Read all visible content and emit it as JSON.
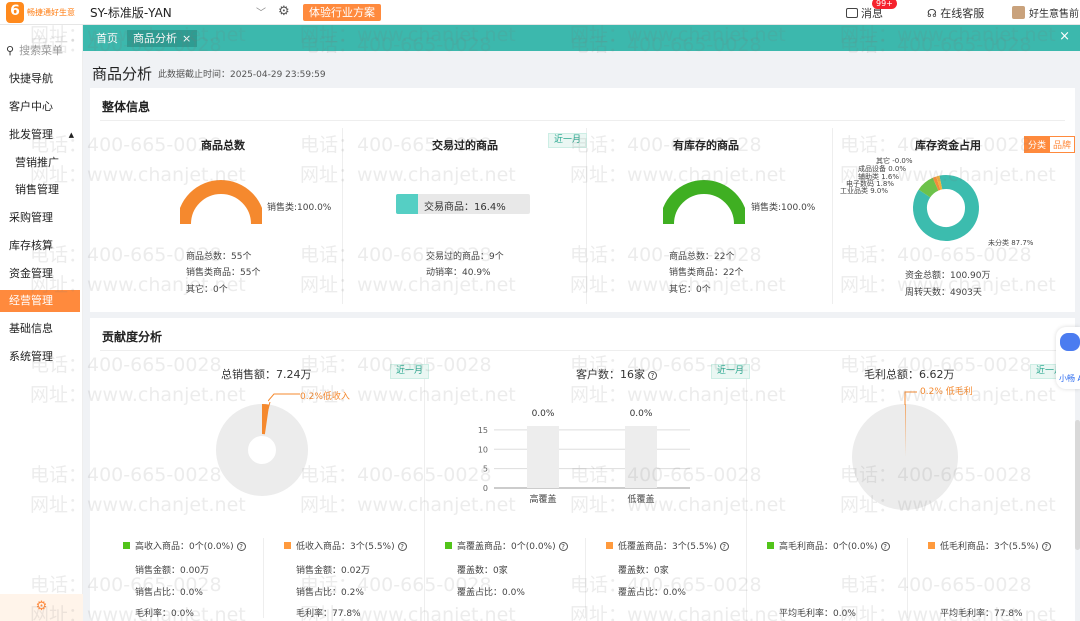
{
  "header": {
    "logo_text": "畅捷通好生意",
    "logo_sub": "标准版",
    "org_name": "SY-标准版-YAN",
    "plan_button": "体验行业方案",
    "messages_label": "消息",
    "messages_badge": "99+",
    "service_label": "在线客服",
    "user_name": "好生意售前"
  },
  "sidebar": {
    "search_placeholder": "搜索菜单",
    "items": [
      {
        "label": "快捷导航"
      },
      {
        "label": "客户中心"
      },
      {
        "label": "批发管理"
      },
      {
        "label": "营销推广"
      },
      {
        "label": "销售管理"
      },
      {
        "label": "采购管理"
      },
      {
        "label": "库存核算"
      },
      {
        "label": "资金管理"
      },
      {
        "label": "经营管理"
      },
      {
        "label": "基础信息"
      },
      {
        "label": "系统管理"
      }
    ]
  },
  "tabs": [
    {
      "label": "首页"
    },
    {
      "label": "商品分析",
      "close": "×"
    }
  ],
  "tabbar_close": "×",
  "page": {
    "title": "商品分析",
    "subtitle": "此数据截止时间：2025-04-29 23:59:59"
  },
  "overall": {
    "title": "整体信息",
    "total_goods": {
      "title": "商品总数",
      "donut_label": "销售类:100.0%",
      "lines": [
        "商品总数：55个",
        "销售类商品：55个",
        "其它：0个"
      ]
    },
    "traded_goods": {
      "title": "交易过的商品",
      "tag": "近一月",
      "bar_label": "交易商品：16.4%",
      "bar_fraction": 0.164,
      "lines": [
        "交易过的商品：9个",
        "动销率：40.9%"
      ]
    },
    "stocked_goods": {
      "title": "有库存的商品",
      "donut_label": "销售类:100.0%",
      "lines": [
        "商品总数：22个",
        "销售类商品：22个",
        "其它：0个"
      ]
    },
    "inventory_capital": {
      "title": "库存资金占用",
      "toggle": [
        "分类",
        "品牌"
      ],
      "pie_labels": [
        {
          "label": "其它 -0.0%",
          "color": "#7c8cf0"
        },
        {
          "label": "成品设备 0.0%",
          "color": "#a96cf0"
        },
        {
          "label": "辅助类 1.6%",
          "color": "#f0b03c"
        },
        {
          "label": "电子数码 1.8%",
          "color": "#f08c3c"
        },
        {
          "label": "工业品类 9.0%",
          "color": "#6cc24a"
        },
        {
          "label": "未分类 87.7%",
          "color": "#3cbcae"
        }
      ],
      "lines": [
        "资金总额：100.90万",
        "周转天数：4903天"
      ]
    }
  },
  "contribution": {
    "title": "贡献度分析",
    "sales": {
      "title": "总销售额：7.24万",
      "tag": "近一月",
      "pie_label": "0.2%低收入",
      "legend": [
        {
          "label": "高收入商品：0个(0.0%)",
          "color": "#52c41a",
          "lines": [
            "销售金额：0.00万",
            "销售占比：0.0%",
            "毛利率：0.0%"
          ]
        },
        {
          "label": "低收入商品：3个(5.5%)",
          "color": "#ff9a3d",
          "lines": [
            "销售金额：0.02万",
            "销售占比：0.2%",
            "毛利率：77.8%"
          ]
        }
      ]
    },
    "customers": {
      "title": "客户数：16家",
      "tag": "近一月",
      "chart_data": {
        "type": "bar",
        "categories": [
          "高覆盖",
          "低覆盖"
        ],
        "values": [
          16,
          16
        ],
        "data_labels": [
          "0.0%",
          "0.0%"
        ],
        "yticks": [
          "15",
          "10",
          "5",
          "0"
        ],
        "ylim": [
          0,
          16
        ]
      },
      "legend": [
        {
          "label": "高覆盖商品：0个(0.0%)",
          "color": "#52c41a",
          "lines": [
            "覆盖数：0家",
            "覆盖占比：0.0%"
          ]
        },
        {
          "label": "低覆盖商品：3个(5.5%)",
          "color": "#ff9a3d",
          "lines": [
            "覆盖数：0家",
            "覆盖占比：0.0%"
          ]
        }
      ]
    },
    "gross_profit": {
      "title": "毛利总额：6.62万",
      "tag": "近一月",
      "pie_label": "0.2% 低毛利",
      "legend": [
        {
          "label": "高毛利商品：0个(0.0%)",
          "color": "#52c41a",
          "lines": [
            "平均毛利率：0.0%"
          ]
        },
        {
          "label": "低毛利商品：3个(5.5%)",
          "color": "#ff9a3d",
          "lines": [
            "平均毛利率：77.8%"
          ]
        }
      ]
    }
  },
  "watermark": {
    "phone": "电话：400-665-0028",
    "site": "网址：www.chanjet.net"
  },
  "assistant_label": "小畅 AI"
}
